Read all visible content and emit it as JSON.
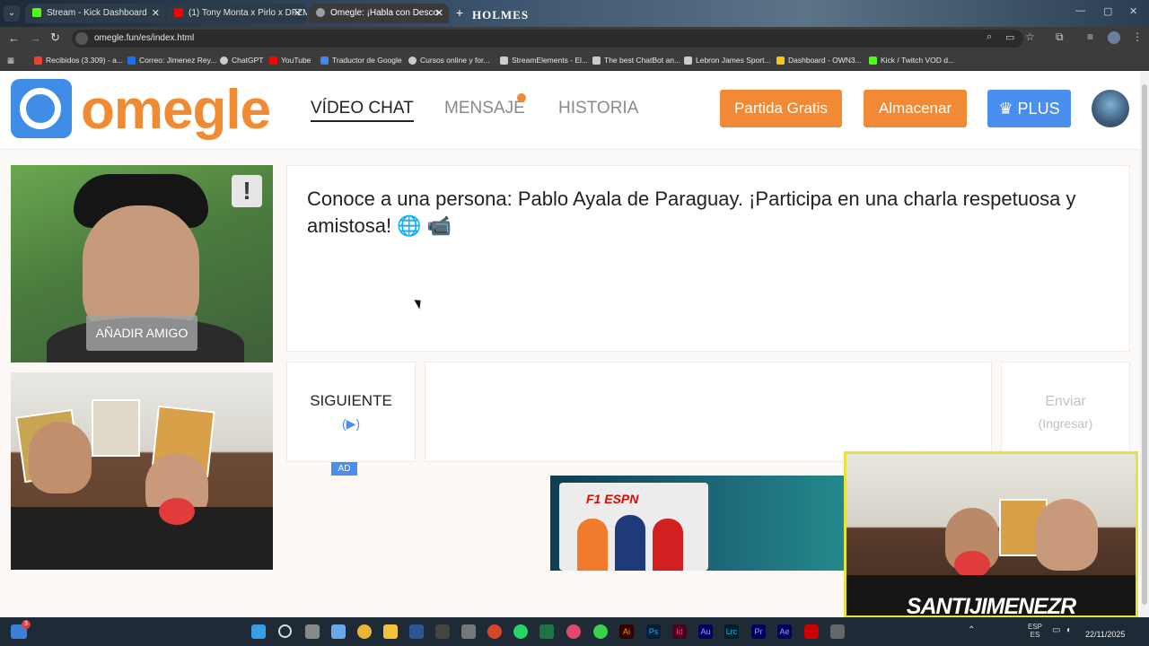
{
  "browser": {
    "tabs": [
      {
        "title": "Stream - Kick Dashboard",
        "color": "#53fc18"
      },
      {
        "title": "(1) Tony Monta x Pirlo x DFZM",
        "color": "#ff0000"
      },
      {
        "title": "Omegle: ¡Habla con Desco",
        "color": "#9aa0a6"
      }
    ],
    "tab_overlay_text": "HOLMES",
    "url": "omegle.fun/es/index.html",
    "bookmarks": [
      {
        "label": "Recibidos (3.309) - a...",
        "color": "#ea4335"
      },
      {
        "label": "Correo: Jimenez Rey...",
        "color": "#1a73e8"
      },
      {
        "label": "ChatGPT",
        "color": "#cccccc"
      },
      {
        "label": "YouTube",
        "color": "#ff0000"
      },
      {
        "label": "Traductor de Google",
        "color": "#4285f4"
      },
      {
        "label": "Cursos online y for...",
        "color": "#cccccc"
      },
      {
        "label": "StreamElements - El...",
        "color": "#cccccc"
      },
      {
        "label": "The best ChatBot an...",
        "color": "#cccccc"
      },
      {
        "label": "Lebron James Sport...",
        "color": "#cccccc"
      },
      {
        "label": "Dashboard - OWN3...",
        "color": "#f5c518"
      },
      {
        "label": "Kick / Twitch VOD d...",
        "color": "#53fc18"
      }
    ]
  },
  "site": {
    "logo_text": "omegle",
    "nav": {
      "video_chat": "VÍDEO CHAT",
      "message": "MENSAJE",
      "history": "HISTORIA"
    },
    "buttons": {
      "free_match": "Partida Gratis",
      "store": "Almacenar",
      "plus": "PLUS"
    }
  },
  "chat": {
    "stranger_message": "Conoce a una persona: Pablo Ayala de Paraguay. ¡Participa en una charla respetuosa y amistosa! 🌐 📹",
    "add_friend": "AÑADIR AMIGO",
    "report_symbol": "!",
    "next_label": "SIGUIENTE",
    "next_arrow": "(▶)",
    "send_label": "Enviar",
    "send_sub": "(Ingresar)",
    "ad_badge": "AD"
  },
  "ad": {
    "brand": "F1 ESPN"
  },
  "stream_overlay": {
    "name": "SANTIJIMENEZR"
  },
  "taskbar": {
    "lang": "ESP",
    "lang2": "ES",
    "date": "22/11/2025",
    "notification_count": "3"
  },
  "colors": {
    "accent_orange": "#f28a35",
    "plus_blue": "#4a8ff0",
    "overlay_yellow": "#e8e23a"
  }
}
